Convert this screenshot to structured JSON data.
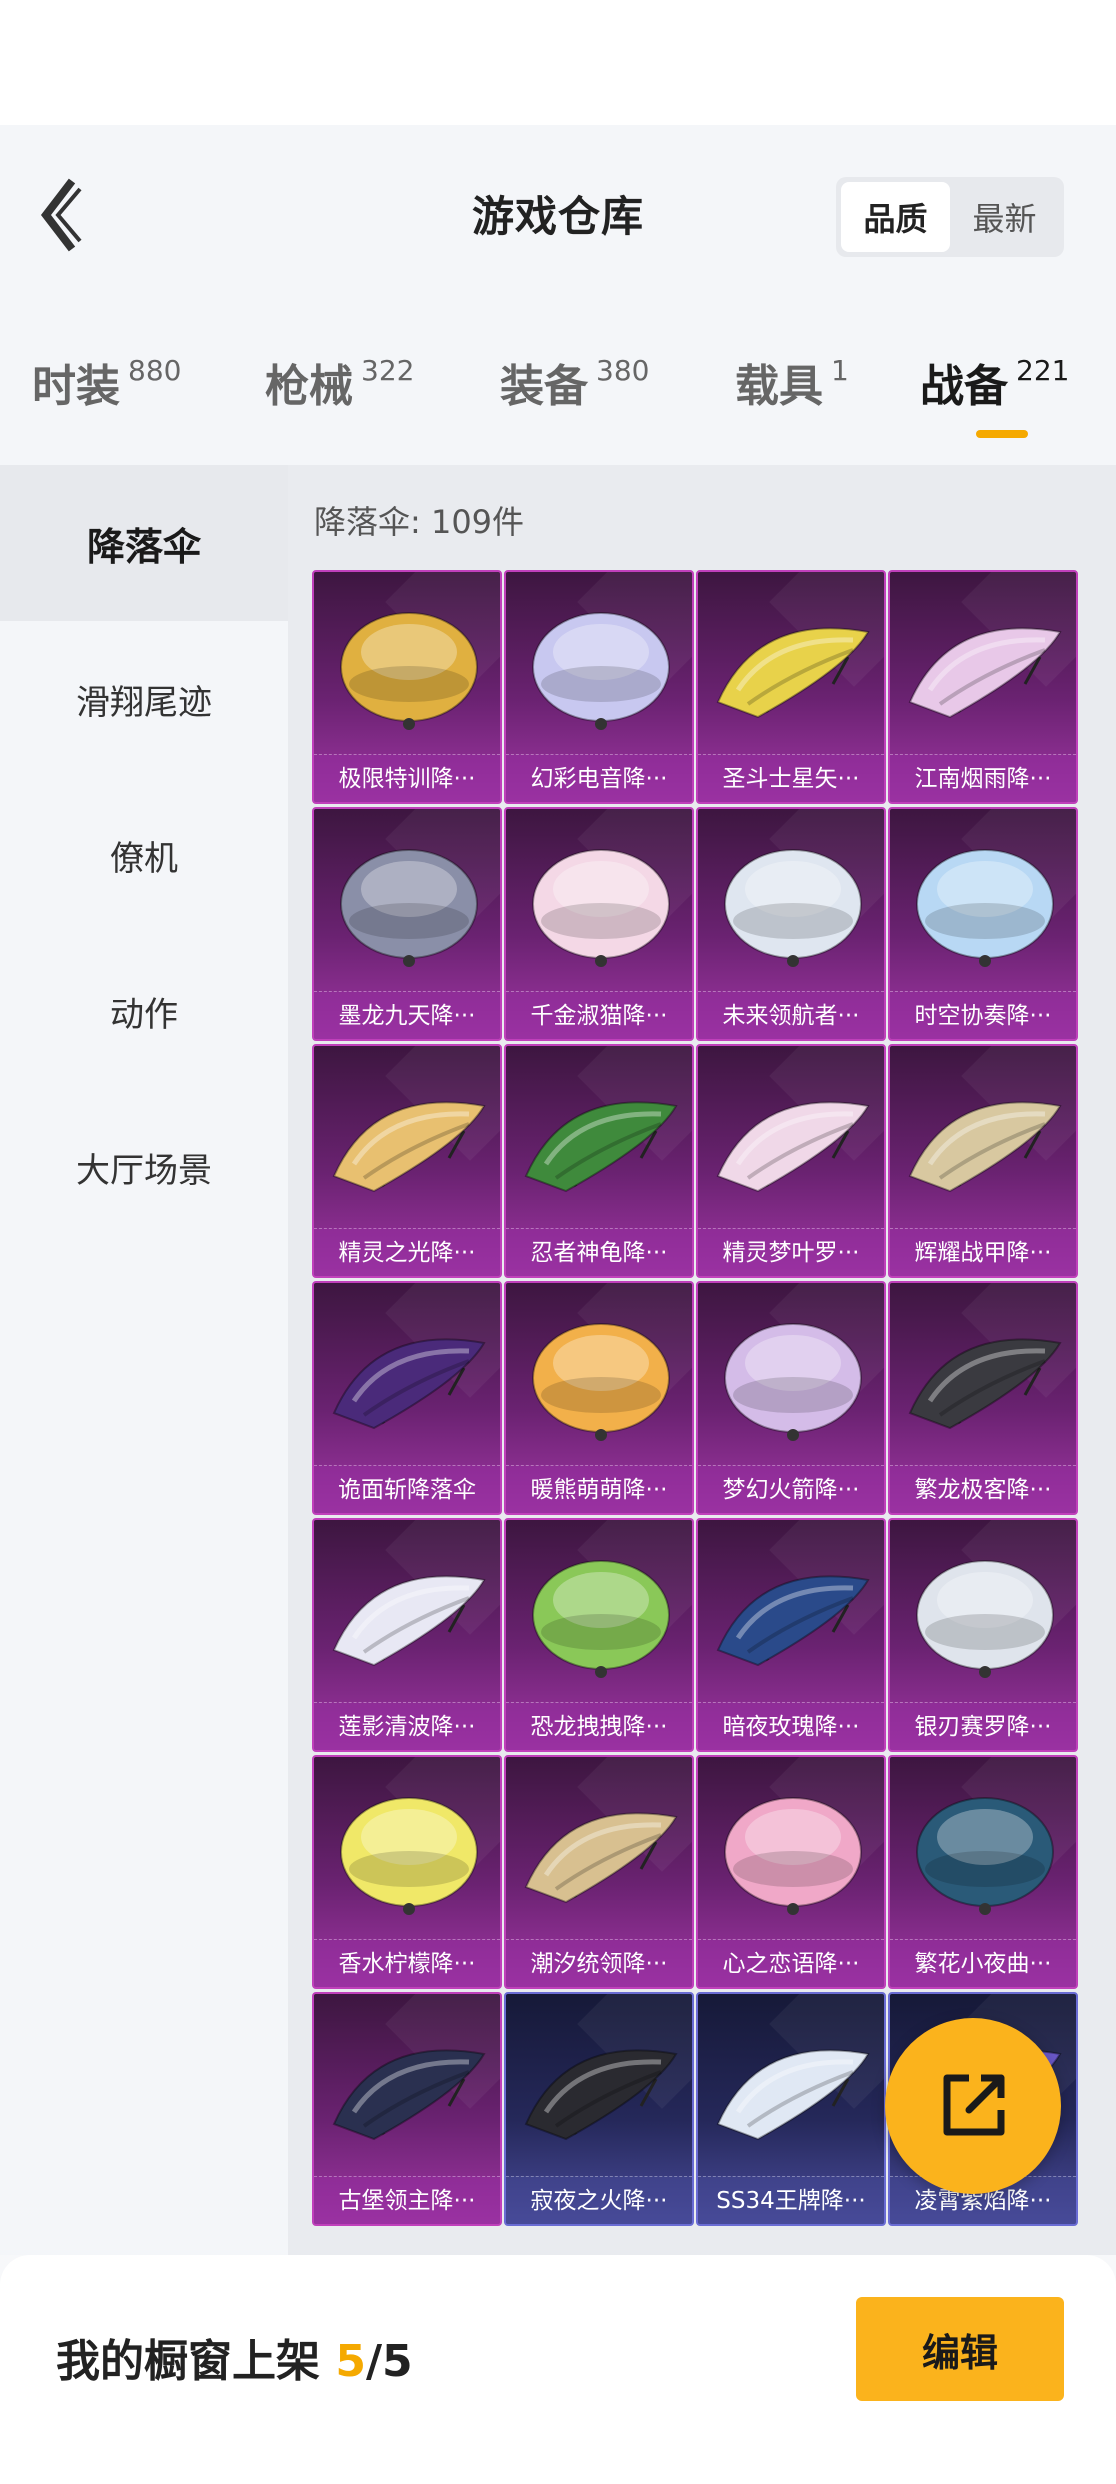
{
  "header": {
    "title": "游戏仓库",
    "sort_options": [
      {
        "label": "品质",
        "active": true
      },
      {
        "label": "最新",
        "active": false
      }
    ]
  },
  "category_tabs": [
    {
      "label": "时装",
      "count": "880",
      "active": false
    },
    {
      "label": "枪械",
      "count": "322",
      "active": false
    },
    {
      "label": "装备",
      "count": "380",
      "active": false
    },
    {
      "label": "载具",
      "count": "1",
      "active": false
    },
    {
      "label": "战备",
      "count": "221",
      "active": true
    }
  ],
  "sidebar": {
    "items": [
      {
        "label": "降落伞",
        "active": true
      },
      {
        "label": "滑翔尾迹",
        "active": false
      },
      {
        "label": "僚机",
        "active": false
      },
      {
        "label": "动作",
        "active": false
      },
      {
        "label": "大厅场景",
        "active": false
      }
    ]
  },
  "content": {
    "count_label": "降落伞: 109件",
    "items": [
      {
        "name": "极限特训降···",
        "color": "#e0b040",
        "shape": "round",
        "tier": "purple"
      },
      {
        "name": "幻彩电音降···",
        "color": "#c8c8f0",
        "shape": "round",
        "tier": "purple"
      },
      {
        "name": "圣斗士星矢···",
        "color": "#e8d24a",
        "shape": "wing",
        "tier": "purple"
      },
      {
        "name": "江南烟雨降···",
        "color": "#e8c8e8",
        "shape": "wing",
        "tier": "purple"
      },
      {
        "name": "墨龙九天降···",
        "color": "#8a8fa8",
        "shape": "round",
        "tier": "purple"
      },
      {
        "name": "千金淑猫降···",
        "color": "#f4d8e6",
        "shape": "round",
        "tier": "purple"
      },
      {
        "name": "未来领航者···",
        "color": "#dfe6f0",
        "shape": "round",
        "tier": "purple"
      },
      {
        "name": "时空协奏降···",
        "color": "#b8d8f4",
        "shape": "round",
        "tier": "purple"
      },
      {
        "name": "精灵之光降···",
        "color": "#e8c070",
        "shape": "wing",
        "tier": "purple"
      },
      {
        "name": "忍者神龟降···",
        "color": "#3f8a3c",
        "shape": "wing",
        "tier": "purple"
      },
      {
        "name": "精灵梦叶罗···",
        "color": "#f0d8e8",
        "shape": "wing",
        "tier": "purple"
      },
      {
        "name": "辉耀战甲降···",
        "color": "#d8c8a0",
        "shape": "wing",
        "tier": "purple"
      },
      {
        "name": "诡面斩降落伞",
        "color": "#4a2a7a",
        "shape": "wing",
        "tier": "purple"
      },
      {
        "name": "暖熊萌萌降···",
        "color": "#f2b04a",
        "shape": "round",
        "tier": "purple"
      },
      {
        "name": "梦幻火箭降···",
        "color": "#d4bce8",
        "shape": "round",
        "tier": "purple"
      },
      {
        "name": "繁龙极客降···",
        "color": "#3a3a40",
        "shape": "wing",
        "tier": "purple"
      },
      {
        "name": "莲影清波降···",
        "color": "#e8e8f4",
        "shape": "wing",
        "tier": "purple"
      },
      {
        "name": "恐龙拽拽降···",
        "color": "#8ac858",
        "shape": "round",
        "tier": "purple"
      },
      {
        "name": "暗夜玫瑰降···",
        "color": "#2a4a8a",
        "shape": "wing",
        "tier": "purple"
      },
      {
        "name": "银刃赛罗降···",
        "color": "#dfe4ec",
        "shape": "round",
        "tier": "purple"
      },
      {
        "name": "香水柠檬降···",
        "color": "#f0e868",
        "shape": "round",
        "tier": "purple"
      },
      {
        "name": "潮汐统领降···",
        "color": "#d8c090",
        "shape": "wing",
        "tier": "purple"
      },
      {
        "name": "心之恋语降···",
        "color": "#f0a8c8",
        "shape": "round",
        "tier": "purple"
      },
      {
        "name": "繁花小夜曲···",
        "color": "#2a5a78",
        "shape": "round",
        "tier": "purple"
      },
      {
        "name": "古堡领主降···",
        "color": "#2a3050",
        "shape": "wing",
        "tier": "purple"
      },
      {
        "name": "寂夜之火降···",
        "color": "#2a2a30",
        "shape": "wing",
        "tier": "blue"
      },
      {
        "name": "SS34王牌降···",
        "color": "#e0e8f4",
        "shape": "wing",
        "tier": "blue"
      },
      {
        "name": "凌霄紫焰降···",
        "color": "#6a58c8",
        "shape": "wing",
        "tier": "blue"
      }
    ]
  },
  "footer": {
    "showcase_label": "我的橱窗上架 ",
    "showcase_current": "5",
    "showcase_total": "/5",
    "edit_label": "编辑"
  },
  "icons": {
    "back": "chevron-left-icon",
    "share": "external-link-icon"
  },
  "colors": {
    "accent": "#fbb31c",
    "tab_indicator": "#f5a900",
    "purple_tier": "#a036a4",
    "blue_tier": "#4a4c9c"
  }
}
